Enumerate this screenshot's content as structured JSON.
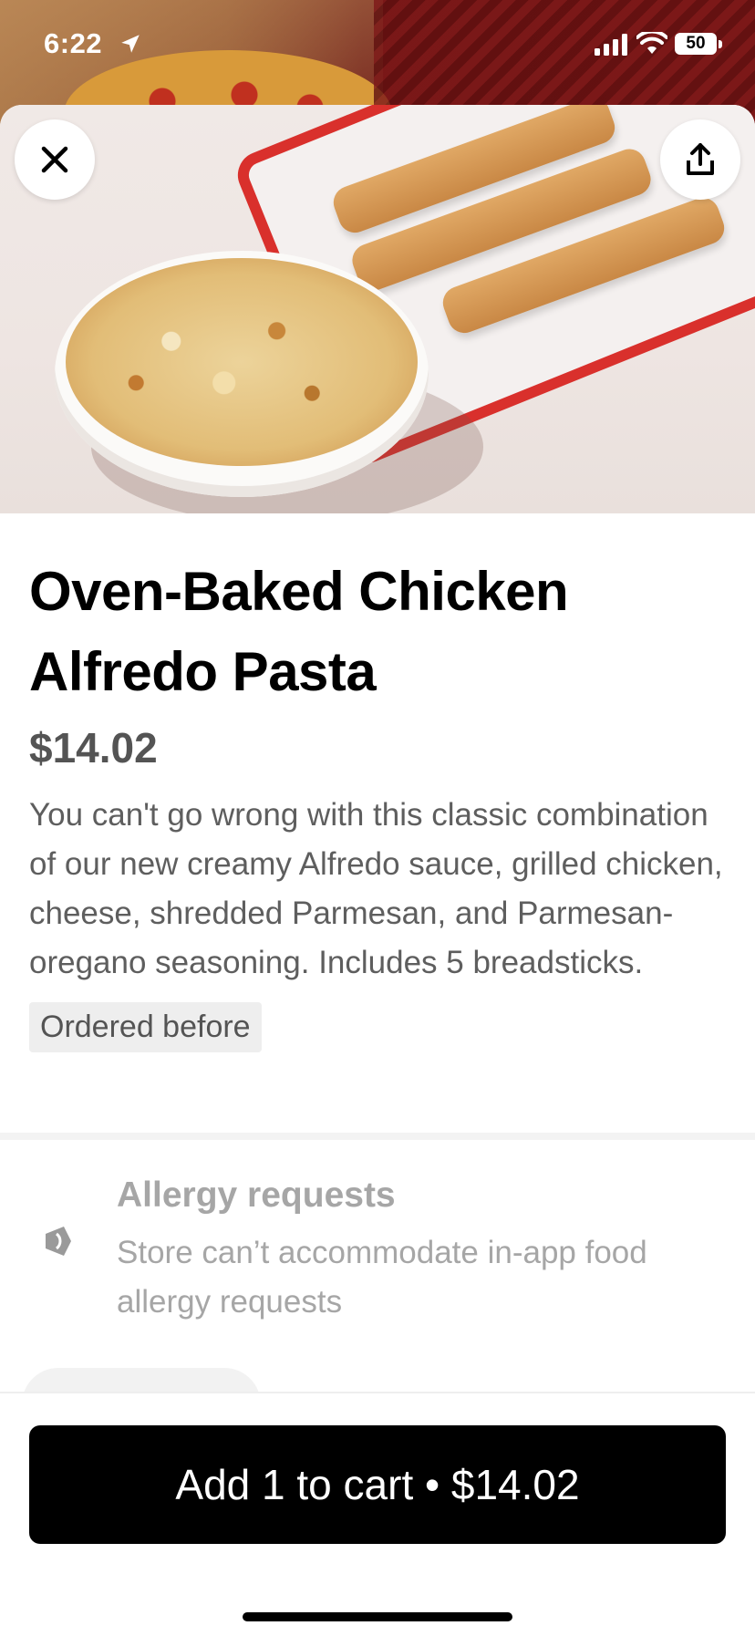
{
  "status_bar": {
    "time": "6:22",
    "battery": "50"
  },
  "item": {
    "title": "Oven-Baked Chicken Alfredo Pasta",
    "price": "$14.02",
    "description": "You can't go wrong with this classic combination of our new creamy Alfredo sauce, grilled chicken, cheese, shredded Parmesan, and Parmesan-oregano seasoning. Includes 5 breadsticks.",
    "badge": "Ordered before"
  },
  "allergy": {
    "title": "Allergy requests",
    "text": "Store can’t accommodate in-app food allergy requests"
  },
  "cta": {
    "label": "Add 1 to cart • $14.02"
  },
  "icons": {
    "close": "close-icon",
    "share": "share-icon",
    "allergy": "allergy-icon",
    "location": "location-arrow-icon",
    "signal": "signal-icon",
    "wifi": "wifi-icon"
  }
}
